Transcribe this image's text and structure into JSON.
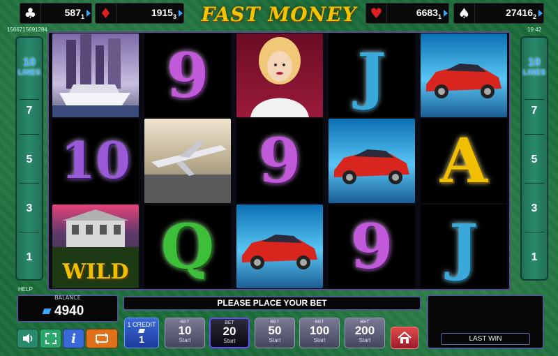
{
  "jackpots": [
    {
      "suit": "clubs",
      "symbol": "♣",
      "value": "587",
      "sub": "1",
      "color": "#ffffff"
    },
    {
      "suit": "diamonds",
      "symbol": "♦",
      "value": "1915",
      "sub": "3",
      "color": "#e02020"
    },
    {
      "suit": "hearts",
      "symbol": "♥",
      "value": "6683",
      "sub": "1",
      "color": "#e02020"
    },
    {
      "suit": "spades",
      "symbol": "♠",
      "value": "27416",
      "sub": "2",
      "color": "#ffffff"
    }
  ],
  "logo": "FAST MONEY",
  "game_id": "1566715691284",
  "clock": "19:42",
  "side_panel": {
    "lines_count": "10",
    "lines_label": "LINES",
    "numbers": [
      "7",
      "5",
      "3",
      "1"
    ]
  },
  "reels": [
    [
      {
        "type": "picture",
        "name": "yacht-city"
      },
      {
        "type": "letter",
        "text": "10"
      },
      {
        "type": "wild",
        "text": "WILD"
      }
    ],
    [
      {
        "type": "letter",
        "text": "9"
      },
      {
        "type": "picture",
        "name": "jet"
      },
      {
        "type": "letter",
        "text": "Q"
      }
    ],
    [
      {
        "type": "picture",
        "name": "woman"
      },
      {
        "type": "letter",
        "text": "9"
      },
      {
        "type": "picture",
        "name": "car"
      }
    ],
    [
      {
        "type": "letter",
        "text": "J"
      },
      {
        "type": "picture",
        "name": "car"
      },
      {
        "type": "letter",
        "text": "9"
      }
    ],
    [
      {
        "type": "picture",
        "name": "car"
      },
      {
        "type": "letter",
        "text": "A"
      },
      {
        "type": "letter",
        "text": "J"
      }
    ]
  ],
  "help_label": "HELP",
  "balance": {
    "label": "BALANCE",
    "value": "4940"
  },
  "message": "PLEASE PLACE YOUR BET",
  "last_win": {
    "label": "LAST WIN"
  },
  "credit": {
    "label": "1 CREDIT",
    "value": "1"
  },
  "bets": [
    {
      "label": "BET",
      "value": "10",
      "start": "Start",
      "selected": false
    },
    {
      "label": "BET",
      "value": "20",
      "start": "Start",
      "selected": true
    },
    {
      "label": "BET",
      "value": "50",
      "start": "Start",
      "selected": false
    },
    {
      "label": "BET",
      "value": "100",
      "start": "Start",
      "selected": false
    },
    {
      "label": "BET",
      "value": "200",
      "start": "Start",
      "selected": false
    }
  ],
  "controls": [
    {
      "name": "sound-icon",
      "glyph": "🔈",
      "color": "#2a8a6c"
    },
    {
      "name": "fullscreen-icon",
      "glyph": "⤢",
      "color": "#2aa86c"
    },
    {
      "name": "info-icon",
      "glyph": "i",
      "color": "#3a6ad8"
    },
    {
      "name": "autoplay-icon",
      "glyph": "⟲",
      "color": "#e0701a"
    }
  ]
}
